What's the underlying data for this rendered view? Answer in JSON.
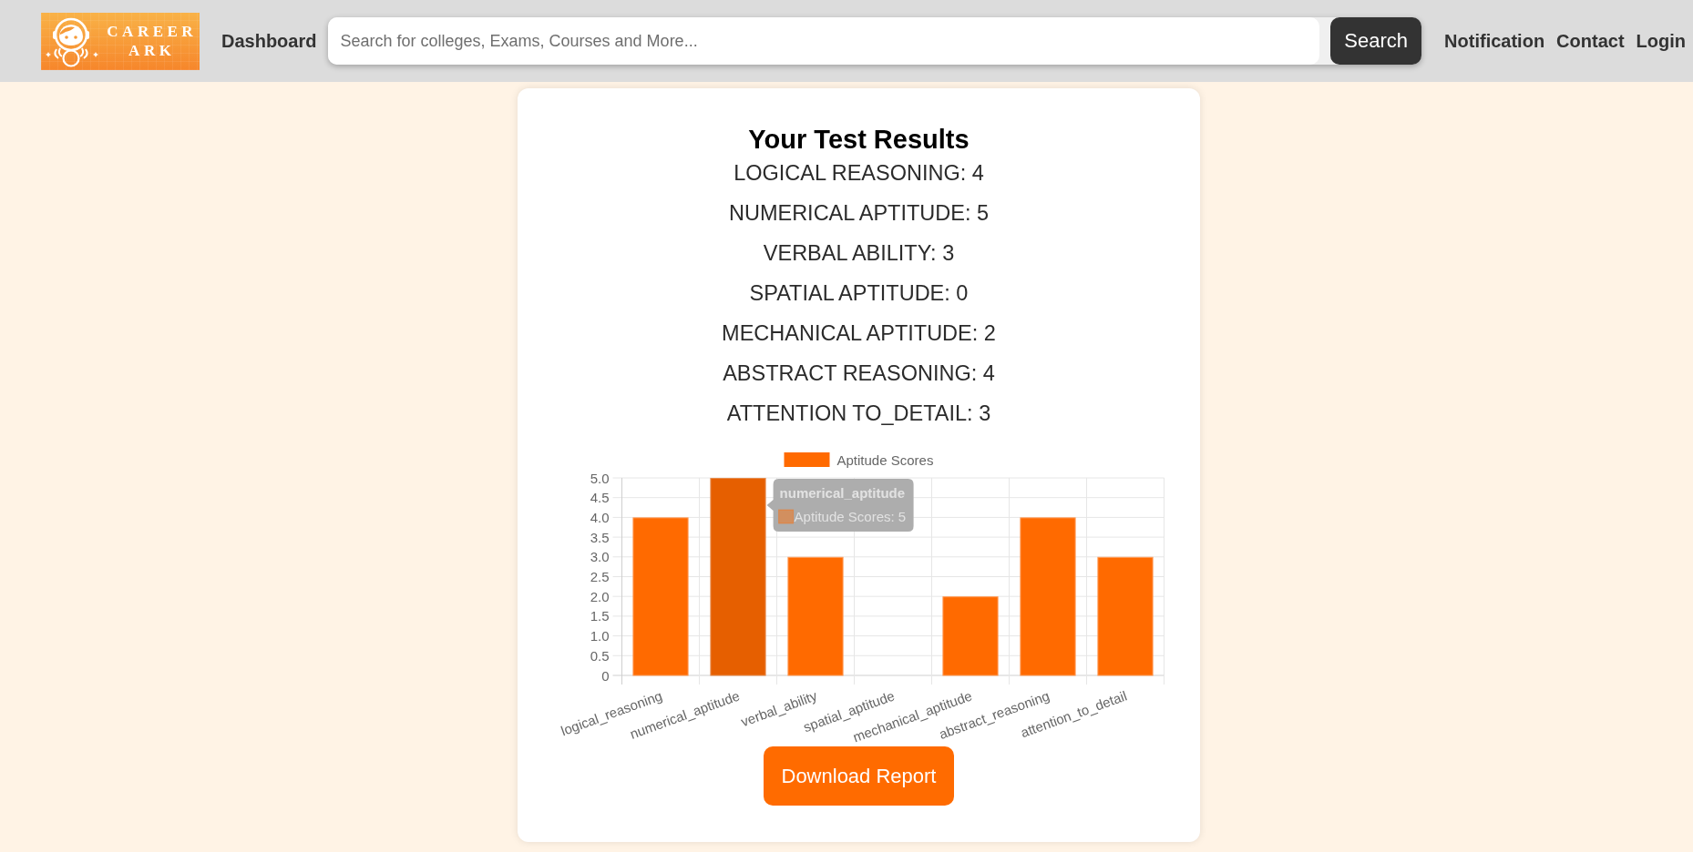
{
  "header": {
    "logo": {
      "lines": [
        "CAREER",
        "ARK"
      ]
    },
    "dashboard_link": "Dashboard",
    "search": {
      "placeholder": "Search for colleges, Exams, Courses and More...",
      "button": "Search"
    },
    "nav_links": [
      "Notification",
      "Contact",
      "Login"
    ]
  },
  "results": {
    "title": "Your Test Results",
    "scores": [
      "LOGICAL REASONING: 4",
      "NUMERICAL APTITUDE: 5",
      "VERBAL ABILITY: 3",
      "SPATIAL APTITUDE: 0",
      "MECHANICAL APTITUDE: 2",
      "ABSTRACT REASONING: 4",
      "ATTENTION TO_DETAIL: 3"
    ],
    "chart": {
      "chart_data": {
        "type": "bar",
        "categories": [
          "logical_reasoning",
          "numerical_aptitude",
          "verbal_ability",
          "spatial_aptitude",
          "mechanical_aptitude",
          "abstract_reasoning",
          "attention_to_detail"
        ],
        "series": [
          {
            "name": "Aptitude Scores",
            "color": "#ff6a00",
            "values": [
              4,
              5,
              3,
              0,
              2,
              4,
              3
            ]
          }
        ],
        "ylim": [
          0,
          5
        ],
        "yticks": [
          {
            "value": 0,
            "label": "0"
          },
          {
            "value": 0.5,
            "label": "0.5"
          },
          {
            "value": 1,
            "label": "1.0"
          },
          {
            "value": 1.5,
            "label": "1.5"
          },
          {
            "value": 2,
            "label": "2.0"
          },
          {
            "value": 2.5,
            "label": "2.5"
          },
          {
            "value": 3,
            "label": "3.0"
          },
          {
            "value": 3.5,
            "label": "3.5"
          },
          {
            "value": 4,
            "label": "4.0"
          },
          {
            "value": 4.5,
            "label": "4.5"
          },
          {
            "value": 5,
            "label": "5.0"
          }
        ],
        "grid": true
      },
      "bars": [
        {
          "hovered": false
        },
        {
          "hovered": true
        },
        {
          "hovered": false
        },
        {
          "hovered": false
        },
        {
          "hovered": false
        },
        {
          "hovered": false
        },
        {
          "hovered": false
        }
      ],
      "tooltip": {
        "title": "numerical_aptitude",
        "label": "Aptitude Scores: 5"
      }
    },
    "download_button": "Download Report"
  }
}
